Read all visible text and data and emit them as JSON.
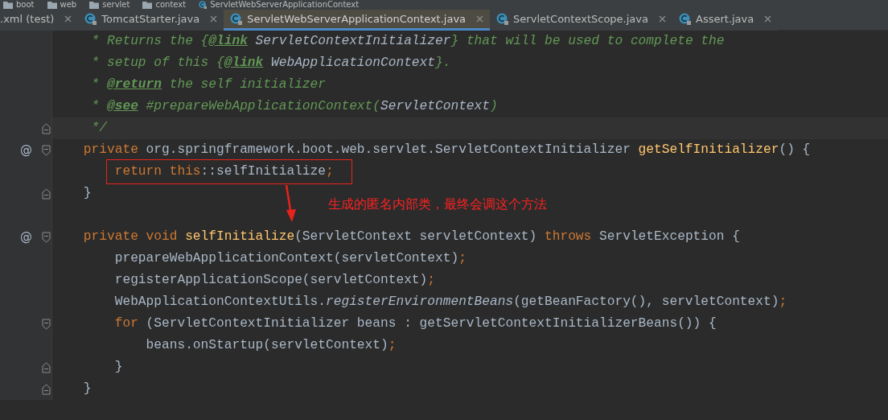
{
  "breadcrumbs": [
    {
      "label": "boot",
      "kind": "folder"
    },
    {
      "label": "web",
      "kind": "folder"
    },
    {
      "label": "servlet",
      "kind": "folder"
    },
    {
      "label": "context",
      "kind": "folder"
    },
    {
      "label": "ServletWebServerApplicationContext",
      "kind": "class"
    }
  ],
  "tabs": [
    {
      "label": ".xml (test)",
      "selected": false,
      "kind": "plain"
    },
    {
      "label": "TomcatStarter.java",
      "selected": false,
      "kind": "class"
    },
    {
      "label": "ServletWebServerApplicationContext.java",
      "selected": true,
      "kind": "class"
    },
    {
      "label": "ServletContextScope.java",
      "selected": false,
      "kind": "class"
    },
    {
      "label": "Assert.java",
      "selected": false,
      "kind": "class"
    }
  ],
  "editor": {
    "lines": [
      {
        "current": false,
        "boxed": false,
        "fold_start": false,
        "fold_end": false,
        "tokens": [
          {
            "text": "     * Returns the {",
            "kind": "comment"
          },
          {
            "text": "@link",
            "kind": "doc_tag"
          },
          {
            "text": " ServletContextInitializer",
            "kind": "doc_ref"
          },
          {
            "text": "} that will be used to complete the",
            "kind": "comment"
          }
        ]
      },
      {
        "current": false,
        "boxed": false,
        "fold_start": false,
        "fold_end": false,
        "tokens": [
          {
            "text": "     * setup of this {",
            "kind": "comment"
          },
          {
            "text": "@link",
            "kind": "doc_tag"
          },
          {
            "text": " WebApplicationContext",
            "kind": "doc_ref"
          },
          {
            "text": "}.",
            "kind": "comment"
          }
        ]
      },
      {
        "current": false,
        "boxed": false,
        "fold_start": false,
        "fold_end": false,
        "tokens": [
          {
            "text": "     * ",
            "kind": "comment"
          },
          {
            "text": "@return",
            "kind": "doc_tag"
          },
          {
            "text": " the self initializer",
            "kind": "comment"
          }
        ]
      },
      {
        "current": false,
        "boxed": false,
        "fold_start": false,
        "fold_end": false,
        "tokens": [
          {
            "text": "     * ",
            "kind": "comment"
          },
          {
            "text": "@see",
            "kind": "doc_tag"
          },
          {
            "text": " #prepareWebApplicationContext(",
            "kind": "comment"
          },
          {
            "text": "ServletContext",
            "kind": "doc_ref"
          },
          {
            "text": ")",
            "kind": "comment"
          }
        ]
      },
      {
        "current": true,
        "boxed": false,
        "fold_start": false,
        "fold_end": true,
        "tokens": [
          {
            "text": "     */",
            "kind": "comment"
          }
        ]
      },
      {
        "current": false,
        "boxed": false,
        "fold_start": true,
        "fold_end": false,
        "gutter_mark": "@",
        "tokens": [
          {
            "text": "    private",
            "kind": "keyword"
          },
          {
            "text": " org.springframework.boot.web.servlet.ServletContextInitializer ",
            "kind": "plain"
          },
          {
            "text": "getSelfInitializer",
            "kind": "method_decl"
          },
          {
            "text": "() {",
            "kind": "plain"
          }
        ]
      },
      {
        "current": false,
        "boxed": true,
        "fold_start": false,
        "fold_end": false,
        "tokens": [
          {
            "text": "        return this",
            "kind": "keyword"
          },
          {
            "text": "::selfInitialize",
            "kind": "plain"
          },
          {
            "text": ";",
            "kind": "keyword"
          }
        ]
      },
      {
        "current": false,
        "boxed": false,
        "fold_start": false,
        "fold_end": true,
        "tokens": [
          {
            "text": "    }",
            "kind": "plain"
          }
        ]
      },
      {
        "current": false,
        "boxed": false,
        "fold_start": false,
        "fold_end": false
      },
      {
        "current": false,
        "boxed": false,
        "fold_start": true,
        "fold_end": false,
        "gutter_mark": "@",
        "tokens": [
          {
            "text": "    private void",
            "kind": "keyword"
          },
          {
            "text": " selfInitialize",
            "kind": "method_decl"
          },
          {
            "text": "(ServletContext servletContext) ",
            "kind": "plain"
          },
          {
            "text": "throws",
            "kind": "keyword"
          },
          {
            "text": " ServletException {",
            "kind": "plain"
          }
        ]
      },
      {
        "current": false,
        "boxed": false,
        "fold_start": false,
        "fold_end": false,
        "tokens": [
          {
            "text": "        prepareWebApplicationContext(servletContext)",
            "kind": "plain"
          },
          {
            "text": ";",
            "kind": "keyword"
          }
        ]
      },
      {
        "current": false,
        "boxed": false,
        "fold_start": false,
        "fold_end": false,
        "tokens": [
          {
            "text": "        registerApplicationScope(servletContext)",
            "kind": "plain"
          },
          {
            "text": ";",
            "kind": "keyword"
          }
        ]
      },
      {
        "current": false,
        "boxed": false,
        "fold_start": false,
        "fold_end": false,
        "tokens": [
          {
            "text": "        WebApplicationContextUtils.",
            "kind": "plain"
          },
          {
            "text": "registerEnvironmentBeans",
            "kind": "static_call"
          },
          {
            "text": "(getBeanFactory(), servletContext)",
            "kind": "plain"
          },
          {
            "text": ";",
            "kind": "keyword"
          }
        ]
      },
      {
        "current": false,
        "boxed": false,
        "fold_start": true,
        "fold_end": false,
        "tokens": [
          {
            "text": "        for",
            "kind": "keyword"
          },
          {
            "text": " (ServletContextInitializer beans : getServletContextInitializerBeans()) {",
            "kind": "plain"
          }
        ]
      },
      {
        "current": false,
        "boxed": false,
        "fold_start": false,
        "fold_end": false,
        "tokens": [
          {
            "text": "            beans.onStartup(servletContext)",
            "kind": "plain"
          },
          {
            "text": ";",
            "kind": "keyword"
          }
        ]
      },
      {
        "current": false,
        "boxed": false,
        "fold_start": false,
        "fold_end": true,
        "tokens": [
          {
            "text": "        }",
            "kind": "plain"
          }
        ]
      },
      {
        "current": false,
        "boxed": false,
        "fold_start": false,
        "fold_end": true,
        "tokens": [
          {
            "text": "    }",
            "kind": "plain"
          }
        ]
      }
    ]
  },
  "annotation": {
    "text": "生成的匿名内部类，最终会调这个方法"
  }
}
